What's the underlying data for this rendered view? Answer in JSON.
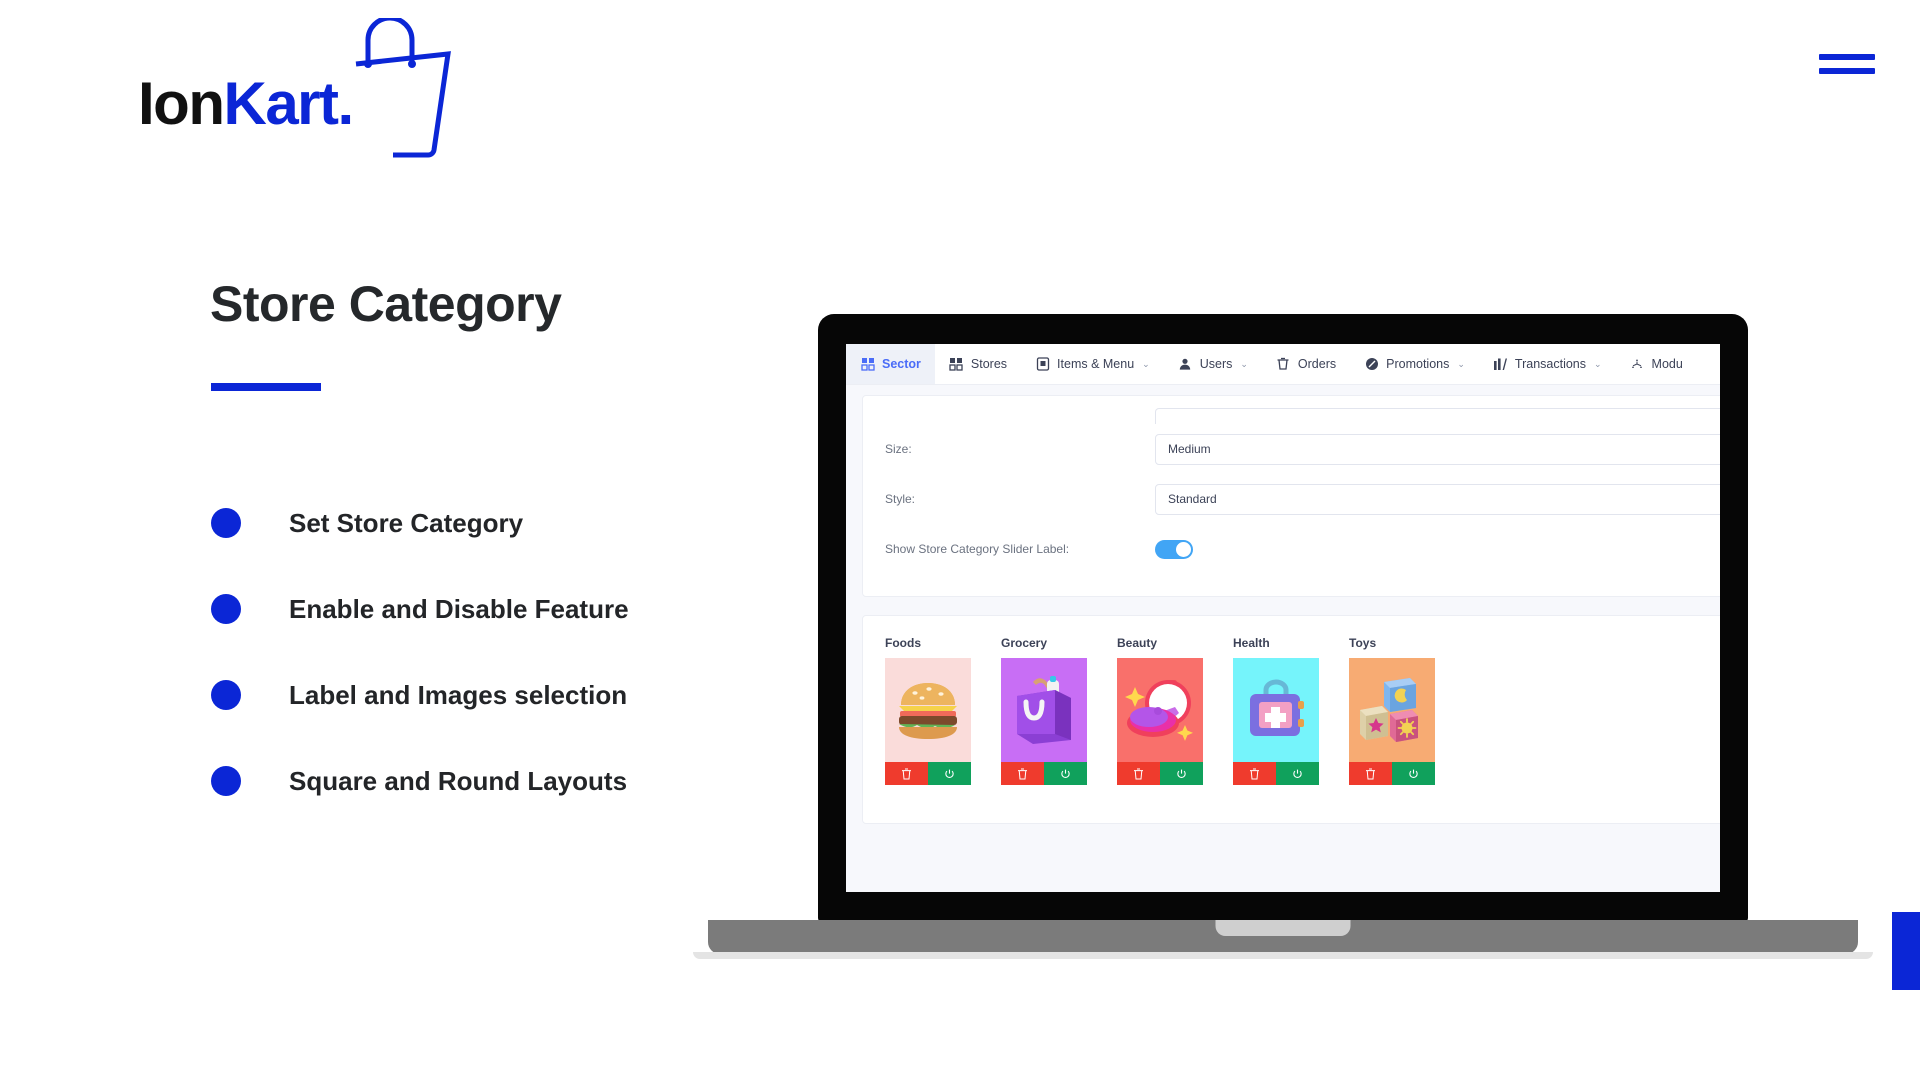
{
  "brand": {
    "part1": "Ion",
    "part2": "Kart.",
    "icon": "shopping-bag-icon",
    "color": "#0b26d6"
  },
  "menu": {
    "icon": "hamburger-menu-icon"
  },
  "hero": {
    "headline": "Store Category",
    "accent_color": "#0b26d6",
    "bullets": [
      {
        "label": "Set Store Category"
      },
      {
        "label": "Enable and Disable Feature"
      },
      {
        "label": "Label and Images selection"
      },
      {
        "label": "Square and Round Layouts"
      }
    ]
  },
  "app": {
    "nav": [
      {
        "label": "Sector",
        "icon": "store-grid-icon",
        "active": true,
        "caret": ""
      },
      {
        "label": "Stores",
        "icon": "store-grid-icon",
        "active": false,
        "caret": ""
      },
      {
        "label": "Items & Menu",
        "icon": "menu-board-icon",
        "active": false,
        "caret": "⌄"
      },
      {
        "label": "Users",
        "icon": "user-icon",
        "active": false,
        "caret": "⌄"
      },
      {
        "label": "Orders",
        "icon": "cart-icon",
        "active": false,
        "caret": ""
      },
      {
        "label": "Promotions",
        "icon": "megaphone-icon",
        "active": false,
        "caret": "⌄"
      },
      {
        "label": "Transactions",
        "icon": "bar-chart-icon",
        "active": false,
        "caret": "⌄"
      },
      {
        "label": "Modu",
        "icon": "modules-icon",
        "active": false,
        "caret": ""
      }
    ],
    "form": {
      "fields": [
        {
          "label": "Size:",
          "value": "Medium"
        },
        {
          "label": "Style:",
          "value": "Standard"
        }
      ],
      "toggle_row": {
        "label": "Show Store Category Slider Label:",
        "state": "on"
      }
    },
    "categories": [
      {
        "name": "Foods",
        "bg": "#fadcda",
        "image": "burger-image",
        "delete_icon": "trash-icon",
        "power_icon": "power-icon"
      },
      {
        "name": "Grocery",
        "bg": "#c86ef5",
        "image": "grocery-bag-image",
        "delete_icon": "trash-icon",
        "power_icon": "power-icon"
      },
      {
        "name": "Beauty",
        "bg": "#f9706b",
        "image": "makeup-mirror-image",
        "delete_icon": "trash-icon",
        "power_icon": "power-icon"
      },
      {
        "name": "Health",
        "bg": "#75f4fb",
        "image": "first-aid-kit-image",
        "delete_icon": "trash-icon",
        "power_icon": "power-icon"
      },
      {
        "name": "Toys",
        "bg": "#f7ab73",
        "image": "toy-blocks-image",
        "delete_icon": "trash-icon",
        "power_icon": "power-icon"
      }
    ],
    "action_colors": {
      "delete": "#ef3b2d",
      "power": "#10a15c",
      "toggle_on": "#41a5f5"
    }
  }
}
